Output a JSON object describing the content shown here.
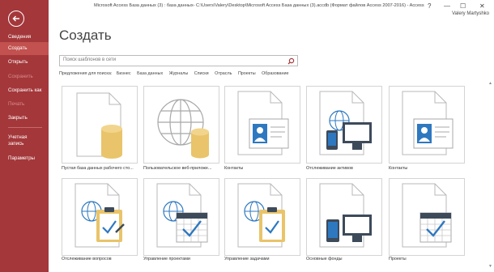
{
  "window": {
    "title": "Microsoft Access База данных (3) : база данных- C:\\Users\\Valery\\Desktop\\Microsoft Access База данных (3).accdb (Формат файлов Access 2007-2016) - Access",
    "help": "?",
    "minimize": "—",
    "maximize": "☐",
    "close": "✕",
    "user": "Valery Martyshko"
  },
  "sidebar": {
    "items": [
      {
        "label": "Сведения",
        "state": "normal"
      },
      {
        "label": "Создать",
        "state": "active"
      },
      {
        "label": "Открыть",
        "state": "normal"
      },
      {
        "label": "Сохранить",
        "state": "disabled"
      },
      {
        "label": "Сохранить как",
        "state": "normal"
      },
      {
        "label": "Печать",
        "state": "disabled"
      },
      {
        "label": "Закрыть",
        "state": "normal"
      },
      {
        "label": "Учетная запись",
        "state": "normal"
      },
      {
        "label": "Параметры",
        "state": "normal"
      }
    ]
  },
  "main": {
    "title": "Создать",
    "search_placeholder": "Поиск шаблонов в сети",
    "suggest_label": "Предложения для поиска:",
    "suggestions": [
      "Бизнес",
      "База данных",
      "Журналы",
      "Списки",
      "Отрасль",
      "Проекты",
      "Образование"
    ],
    "templates": [
      {
        "label": "Пустая база данных рабочего сто...",
        "icon": "blank-database-icon"
      },
      {
        "label": "Пользовательское веб-приложе...",
        "icon": "web-app-icon"
      },
      {
        "label": "Контакты",
        "icon": "contacts-icon"
      },
      {
        "label": "Отслеживание активов",
        "icon": "asset-tracking-icon"
      },
      {
        "label": "Контакты",
        "icon": "contacts-icon"
      },
      {
        "label": "Отслеживание вопросов",
        "icon": "issue-tracking-icon"
      },
      {
        "label": "Управление проектами",
        "icon": "project-management-icon"
      },
      {
        "label": "Управление задачами",
        "icon": "task-management-icon"
      },
      {
        "label": "Основные фонды",
        "icon": "fixed-assets-icon"
      },
      {
        "label": "Проекты",
        "icon": "projects-icon"
      }
    ]
  },
  "colors": {
    "sidebar": "#a4373a",
    "sidebar_active": "#c2514f",
    "accent": "#a4373a",
    "database_gold": "#e9c46a",
    "device_dark": "#3d4a5a",
    "person_blue": "#2e78c0",
    "check_blue": "#2e78c0"
  }
}
